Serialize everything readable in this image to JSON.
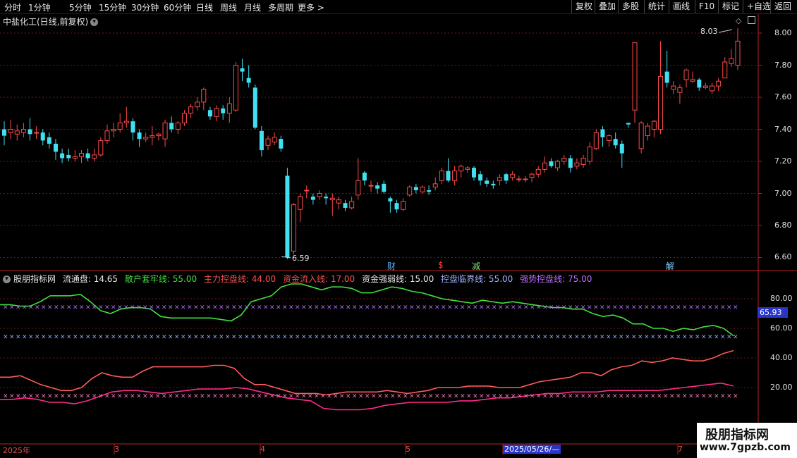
{
  "toolbar": {
    "left_items": [
      "分时",
      "1分钟",
      "5分钟",
      "15分钟",
      "30分钟",
      "60分钟",
      "日线",
      "周线",
      "月线",
      "多周期",
      "更多 >"
    ],
    "active": "日线",
    "right_items": [
      "复权",
      "叠加",
      "多股",
      "统计",
      "画线",
      "F10",
      "标记",
      "+自选",
      "返回"
    ]
  },
  "stock": {
    "title": "中盐化工(日线,前复权)"
  },
  "price_axis": {
    "labels": [
      "8.00",
      "7.80",
      "7.60",
      "7.40",
      "7.20",
      "7.00",
      "6.80",
      "6.60"
    ]
  },
  "price_annotations": {
    "high": "8.03",
    "low": "6.59"
  },
  "events": [
    {
      "label": "财",
      "color": "#5ab4ff"
    },
    {
      "label": "$",
      "color": "#ff4040"
    },
    {
      "label": "减",
      "color": "#7fe07f"
    },
    {
      "label": "解",
      "color": "#7fd0ff"
    }
  ],
  "indicator": {
    "name": "股朋指标网",
    "items": [
      {
        "label": "流通盘: 14.65",
        "color": "#e8e8e8"
      },
      {
        "label": "散户套牢线: 55.00",
        "color": "#40e040"
      },
      {
        "label": "主力控盘线: 44.00",
        "color": "#ff5050"
      },
      {
        "label": "资金流入线: 17.00",
        "color": "#ff5050"
      },
      {
        "label": "资金强弱线: 15.00",
        "color": "#e8e8e8"
      },
      {
        "label": "控盘临界线: 55.00",
        "color": "#9fb0ff"
      },
      {
        "label": "强势控盘线: 75.00",
        "color": "#c070ff"
      }
    ],
    "axis_labels": [
      "80.00",
      "60.00",
      "40.00",
      "20.00"
    ],
    "current_value": "65.93"
  },
  "date_axis": {
    "labels": [
      "2025年",
      "3",
      "4",
      "5",
      "2025/05/26/—",
      "7"
    ]
  },
  "watermark": {
    "line1": "股朋指标网",
    "line2": "www.7gpzb.com"
  },
  "colors": {
    "up": "#ff4a4a",
    "down": "#40e0f0",
    "grid": "#5a1a1a",
    "axis": "#c02020"
  }
}
